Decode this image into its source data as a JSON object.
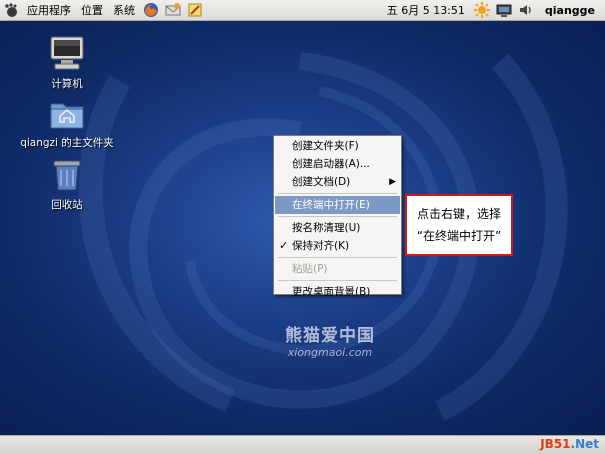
{
  "top_panel": {
    "menus": [
      "应用程序",
      "位置",
      "系统"
    ],
    "clock": "五 6月   5 13:51",
    "user": "qiangge"
  },
  "desktop": {
    "icons": [
      {
        "label": "计算机",
        "icon": "computer-icon"
      },
      {
        "label": "qiangzi 的主文件夹",
        "icon": "home-folder-icon"
      },
      {
        "label": "回收站",
        "icon": "trash-icon"
      }
    ]
  },
  "context_menu": {
    "items": [
      {
        "label": "创建文件夹(F)"
      },
      {
        "label": "创建启动器(A)..."
      },
      {
        "label": "创建文档(D)",
        "submenu": true
      },
      {
        "label": "在终端中打开(E)",
        "selected": true
      },
      {
        "label": "按名称清理(U)"
      },
      {
        "label": "保持对齐(K)",
        "checked": true
      },
      {
        "label": "粘贴(P)",
        "disabled": true
      },
      {
        "label": "更改桌面背景(B)"
      }
    ]
  },
  "callout": {
    "line1": "点击右键，选择",
    "line2": "“在终端中打开”"
  },
  "watermarks": {
    "logo_cn": "熊猫爱中国",
    "logo_en": "xiongmaoi.com",
    "corner_a": "JB51",
    "corner_b": ".Net"
  },
  "colors": {
    "desktop_bg": "#1b3d86",
    "menu_highlight": "#7c98c4",
    "callout_border": "#d01818"
  }
}
